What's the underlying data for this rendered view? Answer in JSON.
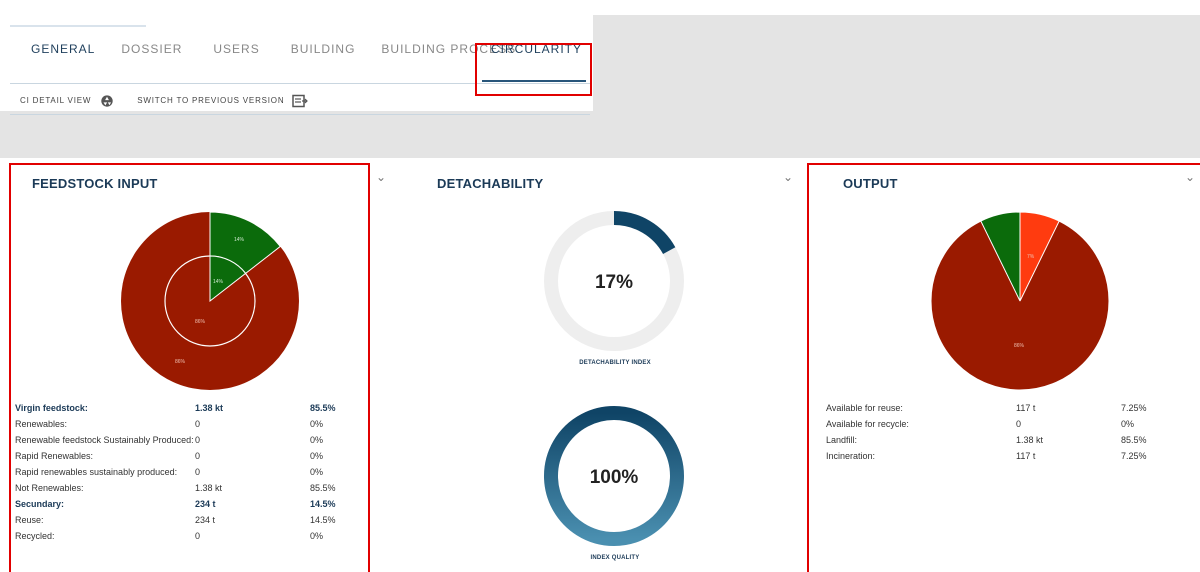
{
  "tabs": [
    {
      "label": "GENERAL"
    },
    {
      "label": "DOSSIER"
    },
    {
      "label": "USERS"
    },
    {
      "label": "BUILDING"
    },
    {
      "label": "BUILDING PROCESS"
    },
    {
      "label": "CIRCULARITY"
    }
  ],
  "subbar": {
    "ci_detail_label": "CI DETAIL VIEW",
    "switch_label": "SWITCH TO PREVIOUS VERSION"
  },
  "feedstock": {
    "title": "FEEDSTOCK INPUT",
    "outer_labels": {
      "green": "14%",
      "red": "86%"
    },
    "inner_labels": {
      "green": "14%",
      "red": "86%"
    },
    "rows": [
      {
        "label": "Virgin feedstock:",
        "value": "1.38 kt",
        "pct": "85.5%",
        "bold": true
      },
      {
        "label": "Renewables:",
        "value": "0",
        "pct": "0%"
      },
      {
        "label": "Renewable feedstock Sustainably Produced:",
        "value": "0",
        "pct": "0%"
      },
      {
        "label": "Rapid Renewables:",
        "value": "0",
        "pct": "0%"
      },
      {
        "label": "Rapid renewables sustainably produced:",
        "value": "0",
        "pct": "0%"
      },
      {
        "label": "Not Renewables:",
        "value": "1.38 kt",
        "pct": "85.5%"
      },
      {
        "label": "Secundary:",
        "value": "234 t",
        "pct": "14.5%",
        "bold": true
      },
      {
        "label": "Reuse:",
        "value": "234 t",
        "pct": "14.5%"
      },
      {
        "label": "Recycled:",
        "value": "0",
        "pct": "0%"
      }
    ]
  },
  "detachability": {
    "title": "DETACHABILITY",
    "index_pct": "17%",
    "index_value": 0.17,
    "index_caption": "DETACHABILITY INDEX",
    "quality_pct": "100%",
    "quality_value": 1.0,
    "quality_caption": "INDEX QUALITY"
  },
  "output": {
    "title": "OUTPUT",
    "labels": {
      "orange": "7%",
      "red": "86%"
    },
    "rows": [
      {
        "label": "Available for reuse:",
        "value": "117 t",
        "pct": "7.25%"
      },
      {
        "label": "Available for recycle:",
        "value": "0",
        "pct": "0%"
      },
      {
        "label": "Landfill:",
        "value": "1.38 kt",
        "pct": "85.5%"
      },
      {
        "label": "Incineration:",
        "value": "117 t",
        "pct": "7.25%"
      }
    ]
  },
  "chart_data": [
    {
      "type": "pie",
      "title": "FEEDSTOCK INPUT",
      "categories": [
        "Secundary",
        "Virgin feedstock"
      ],
      "values": [
        14.5,
        85.5
      ],
      "colors": [
        "#0b6b0b",
        "#9a1a00"
      ]
    },
    {
      "type": "pie",
      "title": "OUTPUT",
      "categories": [
        "Available for reuse",
        "Available for recycle",
        "Landfill",
        "Incineration"
      ],
      "values": [
        7.25,
        0,
        85.5,
        7.25
      ],
      "colors": [
        "#ff3b0f",
        "#0b6b0b",
        "#9a1a00",
        "#0b6b0b"
      ]
    }
  ],
  "colors": {
    "accent": "#1b3a57",
    "highlight_border": "#e10000",
    "pie_red": "#9a1a00",
    "pie_green": "#0b6b0b",
    "pie_orange": "#ff3b0f",
    "ring_bg": "#eeeeee",
    "ring_dark": "#0f4466",
    "ring_light": "#3f86a8"
  }
}
